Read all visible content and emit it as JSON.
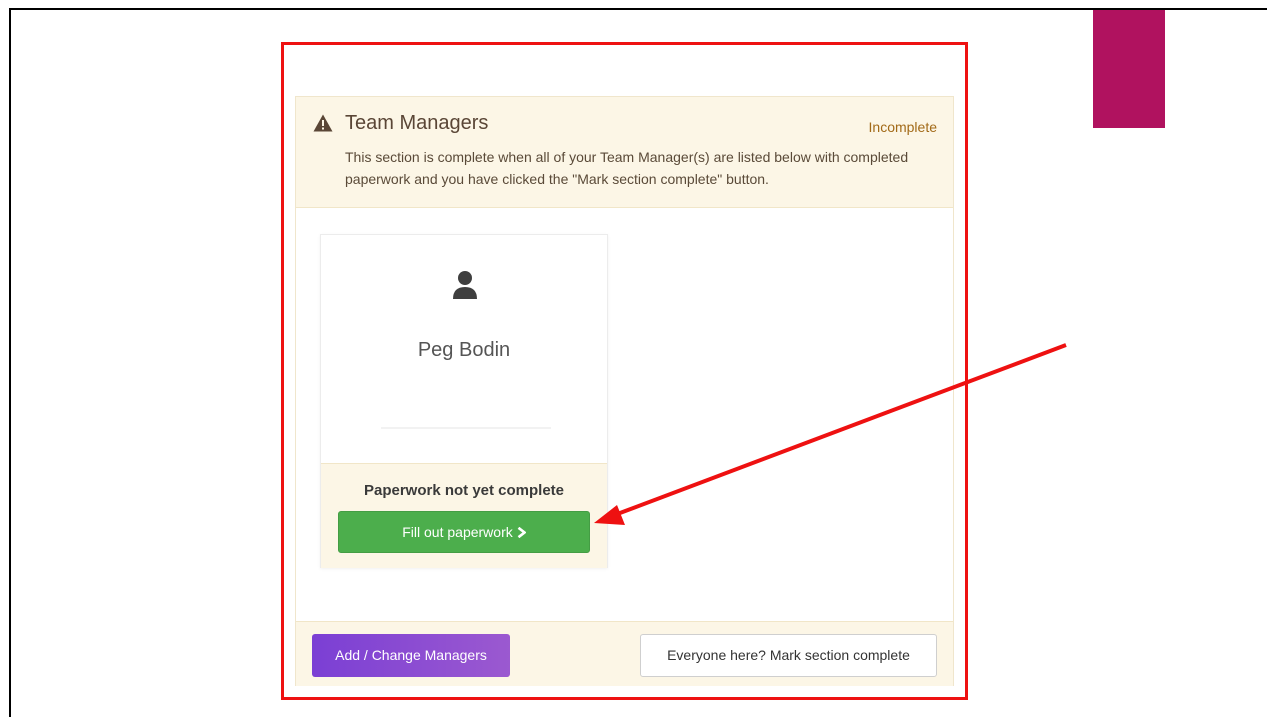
{
  "section": {
    "title": "Team Managers",
    "status": "Incomplete",
    "description": "This section is complete when all of your Team Manager(s) are listed below with completed paperwork and you have clicked the \"Mark section complete\" button.",
    "warning_icon": "warning-triangle-icon"
  },
  "manager": {
    "name": "Peg Bodin",
    "avatar_icon": "user-icon",
    "paperwork_status": "Paperwork not yet complete",
    "fill_button_label": "Fill out paperwork",
    "fill_button_icon": "chevron-right-icon"
  },
  "footer": {
    "add_button_label": "Add / Change Managers",
    "complete_button_label": "Everyone here? Mark section complete"
  },
  "colors": {
    "accent_bar": "#b0125f",
    "annotation_red": "#ee1111",
    "success_green": "#4cae4c",
    "purple_button": "#7b3fd4",
    "panel_cream": "#fcf6e6"
  }
}
